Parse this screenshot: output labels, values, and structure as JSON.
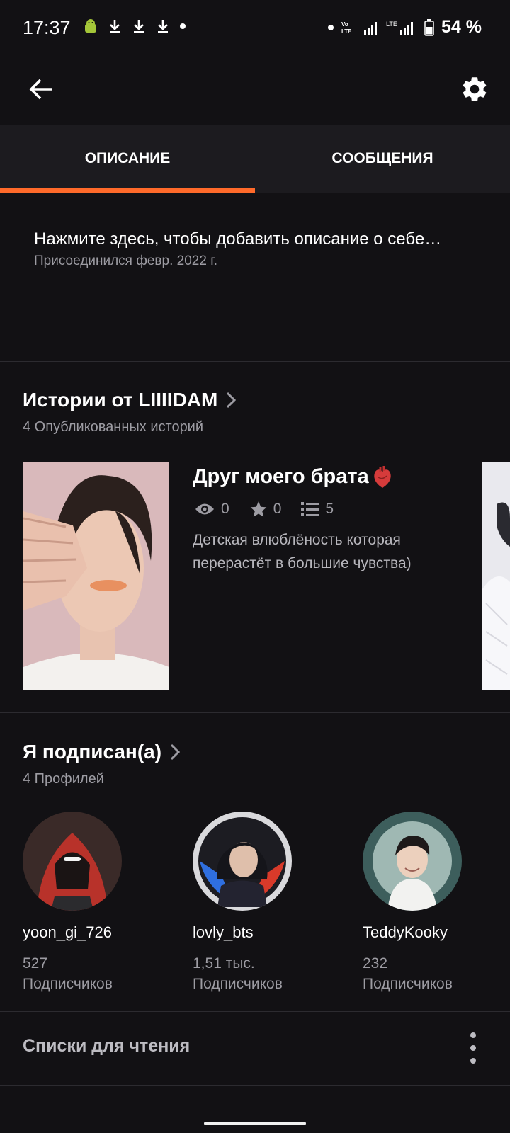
{
  "status_bar": {
    "time": "17:37",
    "battery": "54 %"
  },
  "app_bar": {
    "back_icon": "arrow-left-icon",
    "settings_icon": "gear-icon"
  },
  "tabs": [
    {
      "label": "ОПИСАНИЕ",
      "active": true
    },
    {
      "label": "СООБЩЕНИЯ",
      "active": false
    }
  ],
  "accent_color": "#ff6a2a",
  "about": {
    "description_prompt": "Нажмите здесь, чтобы добавить описание о себе…",
    "joined": "Присоединился февр. 2022 г."
  },
  "stories_section": {
    "title": "Истории от LIIIIDAM",
    "subtitle": "4 Опубликованных историй",
    "stories": [
      {
        "title": "Друг моего брата",
        "reads": "0",
        "votes": "0",
        "parts": "5",
        "description": "Детская влюблёность которая перерастёт в большие чувства)"
      }
    ]
  },
  "following_section": {
    "title": "Я подписан(а)",
    "subtitle": "4 Профилей",
    "profiles": [
      {
        "name": "yoon_gi_726",
        "count": "527",
        "count_label": "Подписчиков"
      },
      {
        "name": "lovly_bts",
        "count": "1,51 тыс.",
        "count_label": "Подписчиков"
      },
      {
        "name": "TeddyKooky",
        "count": "232",
        "count_label": "Подписчиков"
      }
    ]
  },
  "reading_lists": {
    "label": "Списки для чтения"
  }
}
